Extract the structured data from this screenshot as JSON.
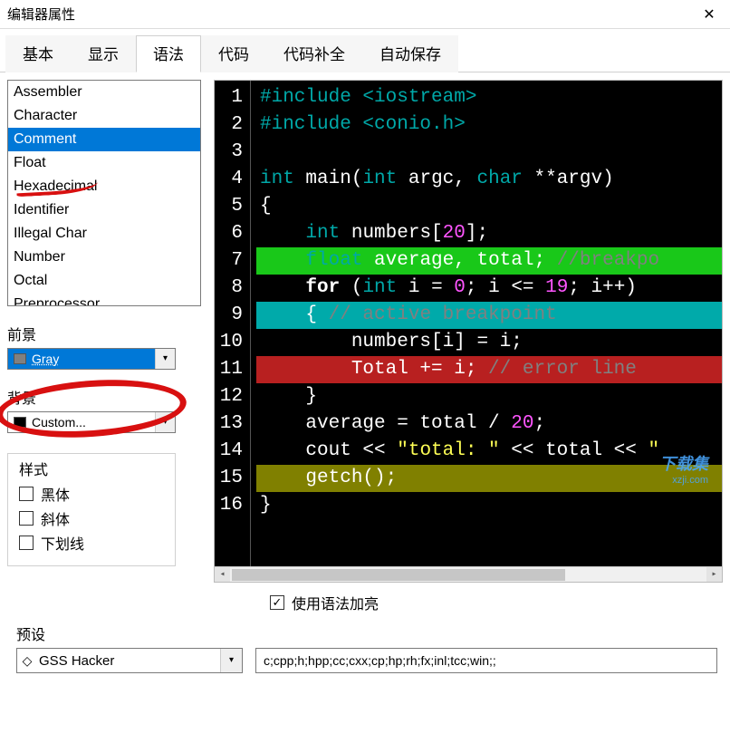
{
  "window": {
    "title": "编辑器属性"
  },
  "tabs": {
    "items": [
      "基本",
      "显示",
      "语法",
      "代码",
      "代码补全",
      "自动保存"
    ],
    "active_index": 2
  },
  "syntax_list": {
    "items": [
      "Assembler",
      "Character",
      "Comment",
      "Float",
      "Hexadecimal",
      "Identifier",
      "Illegal Char",
      "Number",
      "Octal",
      "Preprocessor"
    ],
    "selected_index": 2
  },
  "foreground": {
    "label": "前景",
    "value": "Gray",
    "swatch": "#808080"
  },
  "background": {
    "label": "背景",
    "value": "Custom...",
    "swatch": "#000000"
  },
  "style_group": {
    "label": "样式",
    "bold": {
      "label": "黑体",
      "checked": false
    },
    "italic": {
      "label": "斜体",
      "checked": false
    },
    "underline": {
      "label": "下划线",
      "checked": false
    }
  },
  "code_preview": {
    "lines": [
      {
        "n": 1,
        "tokens": [
          [
            "pp",
            "#include "
          ],
          [
            "pp",
            "<iostream>"
          ]
        ]
      },
      {
        "n": 2,
        "tokens": [
          [
            "pp",
            "#include "
          ],
          [
            "pp",
            "<conio.h>"
          ]
        ]
      },
      {
        "n": 3,
        "tokens": []
      },
      {
        "n": 4,
        "tokens": [
          [
            "ty",
            "int "
          ],
          [
            "w",
            "main("
          ],
          [
            "ty",
            "int "
          ],
          [
            "w",
            "argc, "
          ],
          [
            "ty",
            "char "
          ],
          [
            "w",
            "**argv)"
          ]
        ]
      },
      {
        "n": 5,
        "fold": true,
        "tokens": [
          [
            "w",
            "{"
          ]
        ]
      },
      {
        "n": 6,
        "tokens": [
          [
            "w",
            "    "
          ],
          [
            "ty",
            "int "
          ],
          [
            "w",
            "numbers["
          ],
          [
            "num",
            "20"
          ],
          [
            "w",
            "];"
          ]
        ]
      },
      {
        "n": 7,
        "hl": "green",
        "tokens": [
          [
            "w",
            "    "
          ],
          [
            "ty",
            "float "
          ],
          [
            "w",
            "average, total; "
          ],
          [
            "cmt",
            "//breakpo"
          ]
        ]
      },
      {
        "n": 8,
        "tokens": [
          [
            "w",
            "    "
          ],
          [
            "kw",
            "for "
          ],
          [
            "w",
            "("
          ],
          [
            "ty",
            "int "
          ],
          [
            "w",
            "i = "
          ],
          [
            "num",
            "0"
          ],
          [
            "w",
            "; i <= "
          ],
          [
            "num",
            "19"
          ],
          [
            "w",
            "; i++)"
          ]
        ]
      },
      {
        "n": 9,
        "fold": true,
        "hl": "teal",
        "tokens": [
          [
            "w",
            "    { "
          ],
          [
            "cmt",
            "// active breakpoint"
          ]
        ]
      },
      {
        "n": 10,
        "tokens": [
          [
            "w",
            "        numbers[i] = i;"
          ]
        ]
      },
      {
        "n": 11,
        "hl": "red",
        "tokens": [
          [
            "w",
            "        Total += i; "
          ],
          [
            "cmt",
            "// error line"
          ]
        ]
      },
      {
        "n": 12,
        "tokens": [
          [
            "w",
            "    }"
          ]
        ]
      },
      {
        "n": 13,
        "tokens": [
          [
            "w",
            "    average = total / "
          ],
          [
            "num",
            "20"
          ],
          [
            "w",
            ";"
          ]
        ]
      },
      {
        "n": 14,
        "tokens": [
          [
            "w",
            "    cout << "
          ],
          [
            "str",
            "\"total: \""
          ],
          [
            "w",
            " << total << "
          ],
          [
            "str",
            "\""
          ]
        ]
      },
      {
        "n": 15,
        "hl": "olive",
        "tokens": [
          [
            "w",
            "    getch();"
          ]
        ]
      },
      {
        "n": 16,
        "tokens": [
          [
            "w",
            "}"
          ]
        ]
      }
    ]
  },
  "use_syntax_hl": {
    "label": "使用语法加亮",
    "checked": true
  },
  "preset": {
    "label": "预设",
    "value": "GSS Hacker"
  },
  "extensions": {
    "value": "c;cpp;h;hpp;cc;cxx;cp;hp;rh;fx;inl;tcc;win;;"
  },
  "watermark": {
    "text": "下载集",
    "sub": "xzji.com"
  }
}
